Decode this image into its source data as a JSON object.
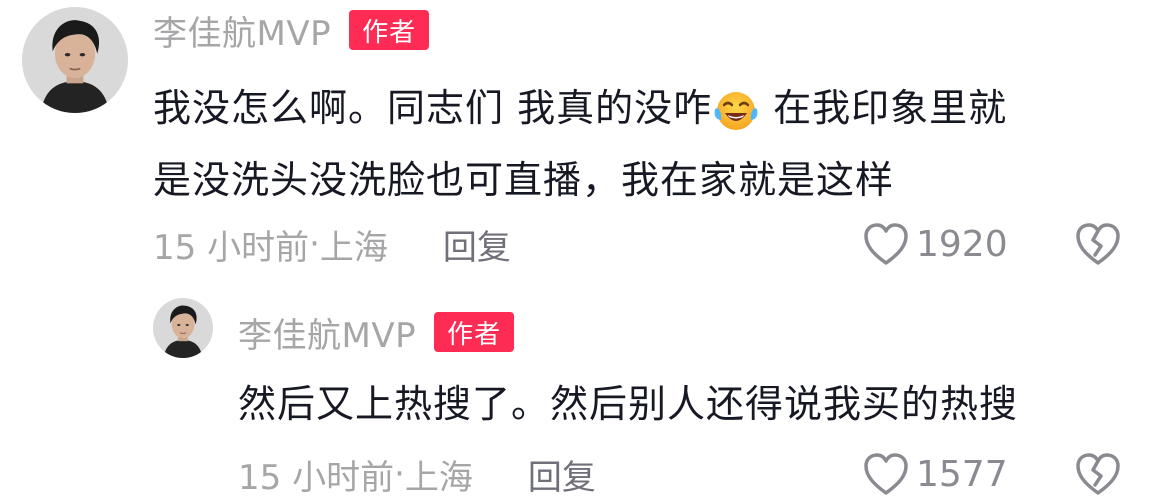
{
  "colors": {
    "author_badge_bg": "#fe2c55",
    "username": "#a6a6a8",
    "comment_text": "#161823",
    "meta_text": "#a6a6a8",
    "reply_text": "#6f7079"
  },
  "comments": [
    {
      "username": "李佳航MVP",
      "author_badge": "作者",
      "text_line1_before_emoji": "我没怎么啊。同志们 我真的没咋",
      "emoji_icon": "laughing-crying-emoji-icon",
      "text_line1_after_emoji": " 在我印象里就",
      "text_line2": "是没洗头没洗脸也可直播，我在家就是这样",
      "time": "15 小时前",
      "location_sep": " · ",
      "location": "上海",
      "reply_label": "回复",
      "like_count": "1920",
      "like_icon": "heart-outline-icon",
      "dislike_icon": "broken-heart-icon"
    },
    {
      "username": "李佳航MVP",
      "author_badge": "作者",
      "text_line1": "然后又上热搜了。然后别人还得说我买的热搜",
      "time": "15 小时前",
      "location_sep": " · ",
      "location": "上海",
      "reply_label": "回复",
      "like_count": "1577",
      "like_icon": "heart-outline-icon",
      "dislike_icon": "broken-heart-icon"
    }
  ]
}
